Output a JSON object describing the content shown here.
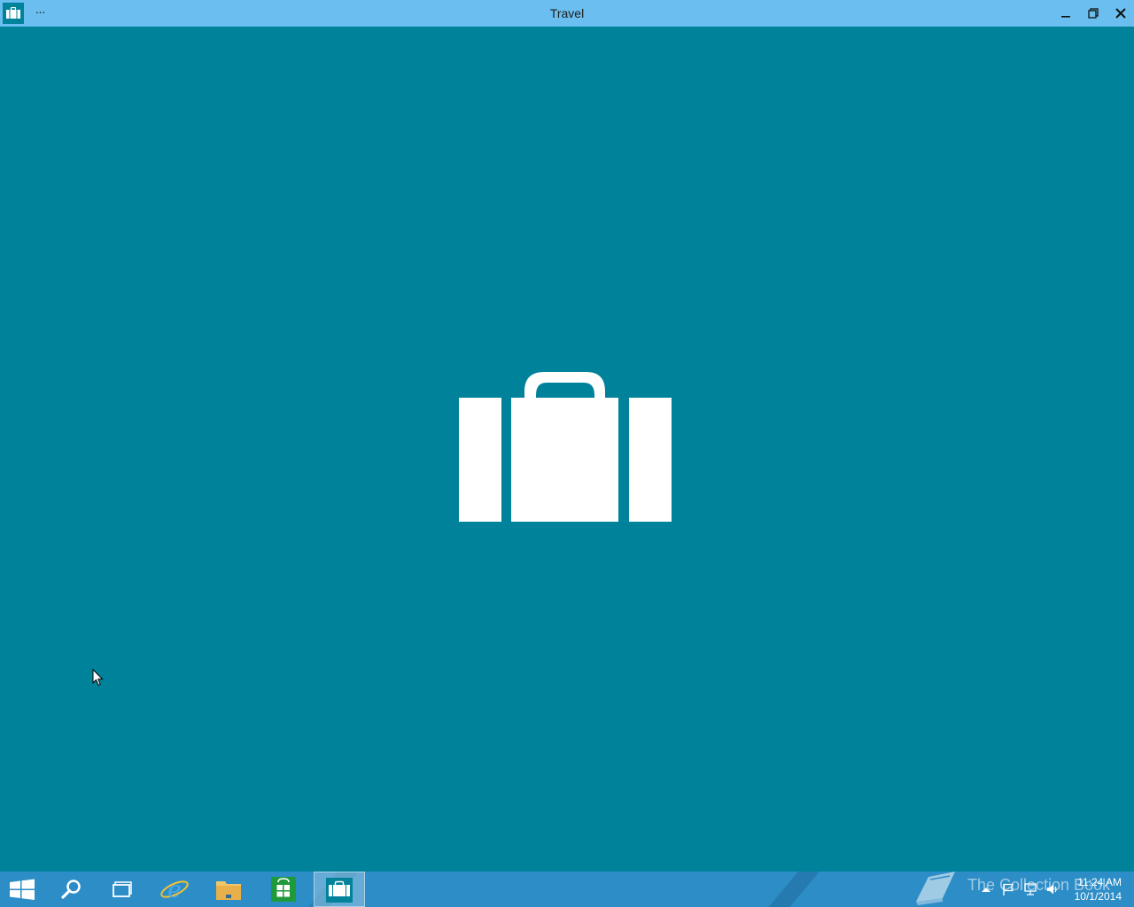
{
  "window": {
    "title": "Travel",
    "more_label": "···",
    "background": "#00829a",
    "titlebar_color": "#6bbff0"
  },
  "taskbar": {
    "items": [
      {
        "name": "start",
        "icon": "windows-logo-icon"
      },
      {
        "name": "search",
        "icon": "search-icon"
      },
      {
        "name": "task-view",
        "icon": "task-view-icon"
      },
      {
        "name": "internet-explorer",
        "icon": "internet-explorer-icon"
      },
      {
        "name": "file-explorer",
        "icon": "folder-icon"
      },
      {
        "name": "store",
        "icon": "store-bag-icon"
      },
      {
        "name": "travel",
        "icon": "briefcase-icon",
        "active": true
      }
    ],
    "watermark": "The Collection Book",
    "clock": {
      "time": "11:24 AM",
      "date": "10/1/2014"
    },
    "color": "#2d8dc6"
  }
}
